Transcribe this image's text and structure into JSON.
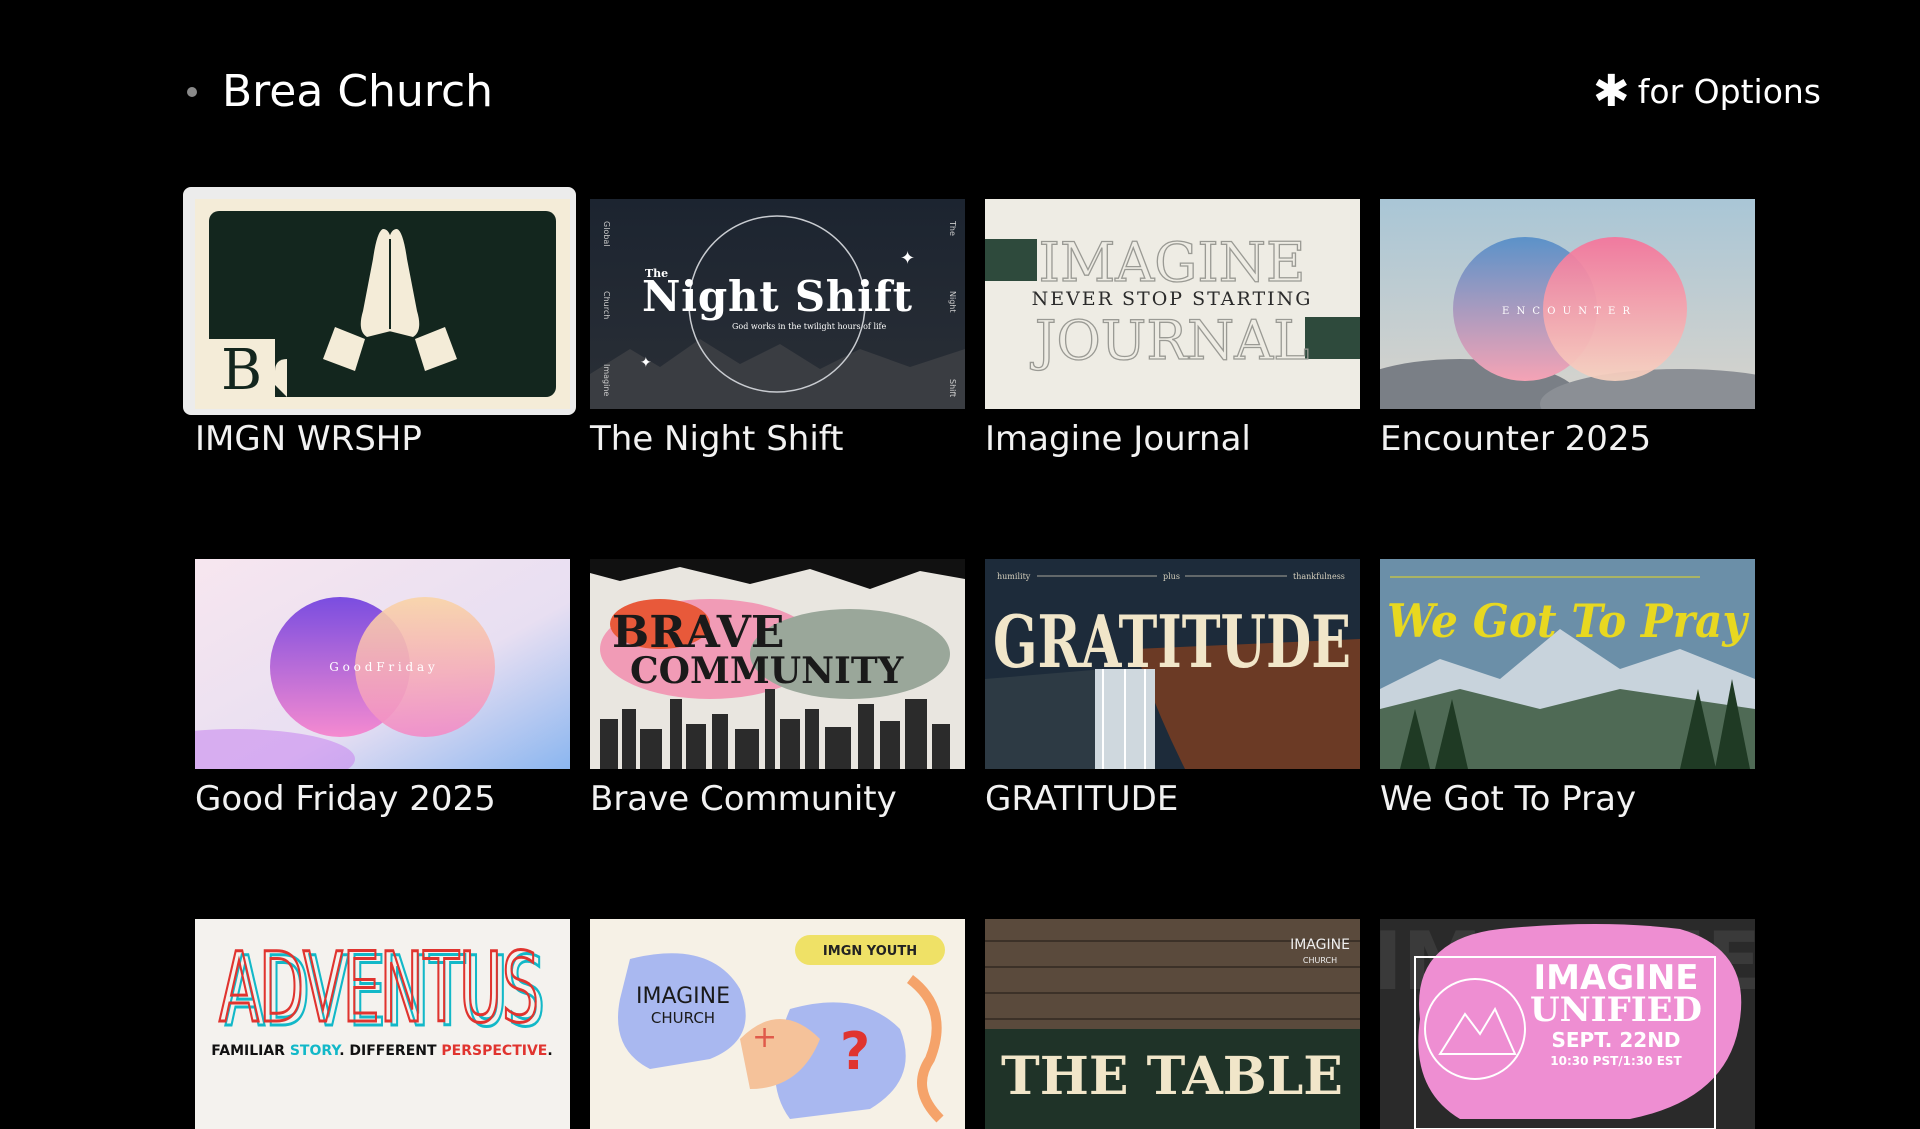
{
  "header": {
    "title": "Brea Church",
    "options_icon": "asterisk-icon",
    "options_label": "for Options"
  },
  "tiles": [
    {
      "label": "IMGN WRSHP",
      "art_text": "B",
      "focused": true
    },
    {
      "label": "The Night Shift",
      "art_title": "Night Shift",
      "art_kicker": "The",
      "art_sub": "God works in the twilight hours of life",
      "side_left": [
        "Global",
        "Church",
        "Imagine"
      ],
      "side_right": [
        "The",
        "Night",
        "Shift"
      ]
    },
    {
      "label": "Imagine Journal",
      "art_line1": "IMAGINE",
      "art_line2": "NEVER STOP STARTING",
      "art_line3": "JOURNAL"
    },
    {
      "label": "Encounter 2025",
      "art_text": "E N C O U N T E R"
    },
    {
      "label": "Good Friday 2025",
      "art_text": "G o o d   F r i d a y"
    },
    {
      "label": "Brave Community",
      "art_line1": "BRAVE",
      "art_line2": "COMMUNITY"
    },
    {
      "label": "GRATITUDE",
      "art_text": "GRATITUDE",
      "art_top": [
        "humility",
        "plus",
        "thankfulness"
      ]
    },
    {
      "label": "We Got To Pray",
      "art_text": "We Got To Pray"
    },
    {
      "label": "",
      "art_text": "ADVENTUS",
      "art_sub": "FAMILIAR STORY. DIFFERENT PERSPECTIVE.",
      "art_sub_parts": [
        "FAMILIAR ",
        "STORY",
        ". DIFFERENT ",
        "PERSPECTIVE",
        "."
      ]
    },
    {
      "label": "",
      "art_badge": "IMGN YOUTH",
      "art_logo1": "IMAGINE",
      "art_logo2": "CHURCH"
    },
    {
      "label": "",
      "art_text": "THE TABLE",
      "art_logo1": "IMAGINE",
      "art_logo2": "CHURCH"
    },
    {
      "label": "",
      "art_line1": "IMAGINE",
      "art_line2": "UNIFIED",
      "art_date": "SEPT. 22ND",
      "art_time": "10:30 PST/1:30 EST",
      "art_bg": "IMAGINE"
    }
  ],
  "colors": {
    "background": "#000000",
    "focus_ring": "#ececec",
    "text": "#ffffff"
  }
}
